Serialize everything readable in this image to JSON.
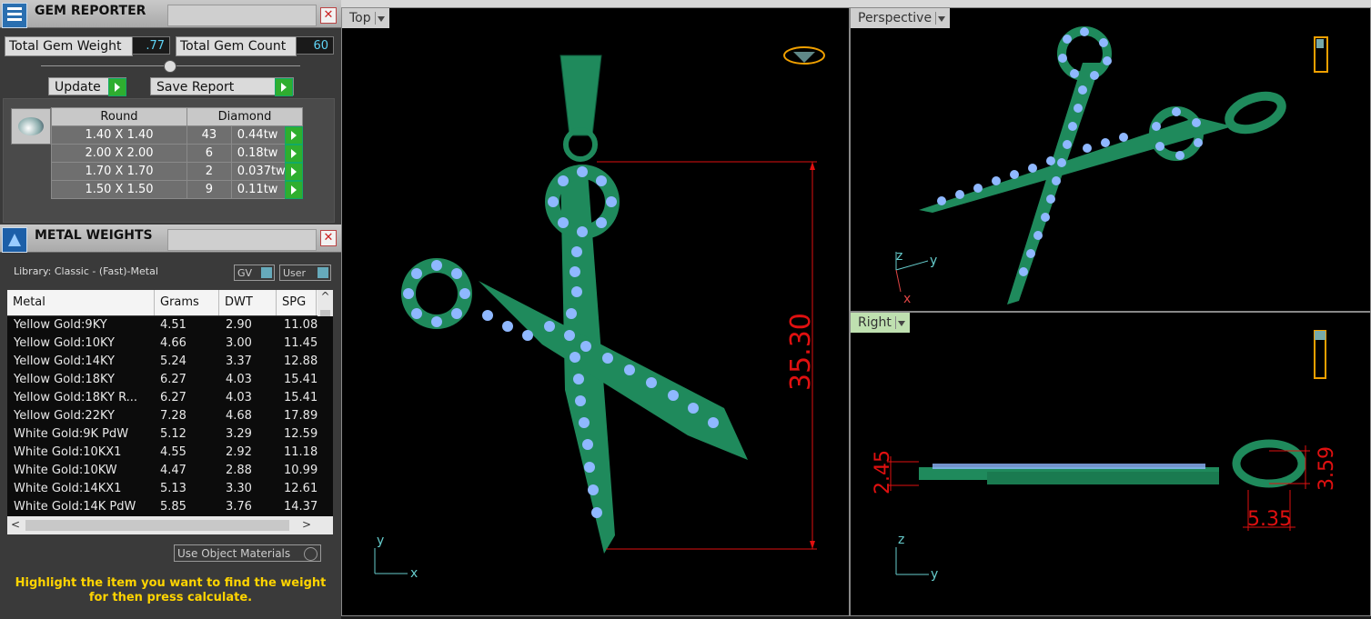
{
  "gem_reporter": {
    "title": "GEM REPORTER",
    "total_gem_weight_label": "Total Gem Weight",
    "total_gem_weight": ".77",
    "total_gem_count_label": "Total Gem Count",
    "total_gem_count": "60",
    "update_label": "Update",
    "save_report_label": "Save Report",
    "shape": "Round",
    "material": "Diamond",
    "rows": [
      {
        "size": "1.40 X 1.40",
        "count": "43",
        "weight": "0.44tw"
      },
      {
        "size": "2.00 X 2.00",
        "count": "6",
        "weight": "0.18tw"
      },
      {
        "size": "1.70 X 1.70",
        "count": "2",
        "weight": "0.037tw"
      },
      {
        "size": "1.50 X 1.50",
        "count": "9",
        "weight": "0.11tw"
      }
    ]
  },
  "metal_weights": {
    "title": "METAL WEIGHTS",
    "library": "Library: Classic - (Fast)-Metal",
    "gv_label": "GV",
    "user_label": "User",
    "columns": [
      "Metal",
      "Grams",
      "DWT",
      "SPG"
    ],
    "rows": [
      {
        "metal": "Yellow Gold:9KY",
        "grams": "4.51",
        "dwt": "2.90",
        "spg": "11.08"
      },
      {
        "metal": "Yellow Gold:10KY",
        "grams": "4.66",
        "dwt": "3.00",
        "spg": "11.45"
      },
      {
        "metal": "Yellow Gold:14KY",
        "grams": "5.24",
        "dwt": "3.37",
        "spg": "12.88"
      },
      {
        "metal": "Yellow Gold:18KY",
        "grams": "6.27",
        "dwt": "4.03",
        "spg": "15.41"
      },
      {
        "metal": "Yellow Gold:18KY R...",
        "grams": "6.27",
        "dwt": "4.03",
        "spg": "15.41"
      },
      {
        "metal": "Yellow Gold:22KY",
        "grams": "7.28",
        "dwt": "4.68",
        "spg": "17.89"
      },
      {
        "metal": "White Gold:9K PdW",
        "grams": "5.12",
        "dwt": "3.29",
        "spg": "12.59"
      },
      {
        "metal": "White Gold:10KX1",
        "grams": "4.55",
        "dwt": "2.92",
        "spg": "11.18"
      },
      {
        "metal": "White Gold:10KW",
        "grams": "4.47",
        "dwt": "2.88",
        "spg": "10.99"
      },
      {
        "metal": "White Gold:14KX1",
        "grams": "5.13",
        "dwt": "3.30",
        "spg": "12.61"
      },
      {
        "metal": "White Gold:14K PdW",
        "grams": "5.85",
        "dwt": "3.76",
        "spg": "14.37"
      }
    ],
    "use_object_materials": "Use Object Materials",
    "hint": "Highlight the item you want to find the weight for then press calculate."
  },
  "viewports": {
    "top": {
      "label": "Top",
      "dimension": "35.30",
      "axis_x": "x",
      "axis_y": "y"
    },
    "perspective": {
      "label": "Perspective",
      "axis_x": "x",
      "axis_y": "y",
      "axis_z": "z"
    },
    "right": {
      "label": "Right",
      "dim_a": "2.45",
      "dim_b": "3.59",
      "dim_c": "5.35",
      "axis_y": "y",
      "axis_z": "z"
    }
  },
  "colors": {
    "metal": "#1f8a5c",
    "gem": "#8fb8ff",
    "dimension": "#e01010",
    "hint": "#ffd400"
  }
}
